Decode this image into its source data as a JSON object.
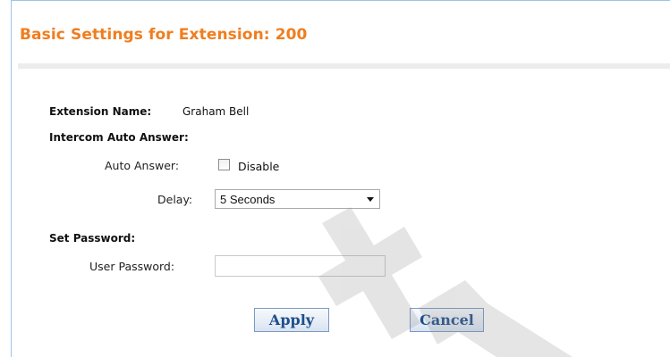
{
  "page": {
    "title": "Basic Settings for Extension: 200"
  },
  "extension": {
    "name_label": "Extension Name:",
    "name_value": "Graham Bell"
  },
  "intercom": {
    "section_label": "Intercom Auto Answer:",
    "auto_answer_label": "Auto Answer:",
    "auto_answer_checkbox_label": "Disable",
    "auto_answer_checked": false,
    "delay_label": "Delay:",
    "delay_selected": "5 Seconds"
  },
  "password": {
    "section_label": "Set Password:",
    "user_password_label": "User Password:",
    "user_password_value": ""
  },
  "buttons": {
    "apply": "Apply",
    "cancel": "Cancel"
  },
  "colors": {
    "title": "#f07d1e",
    "border": "#9ec3e6",
    "button_text": "#1f4e8c"
  }
}
